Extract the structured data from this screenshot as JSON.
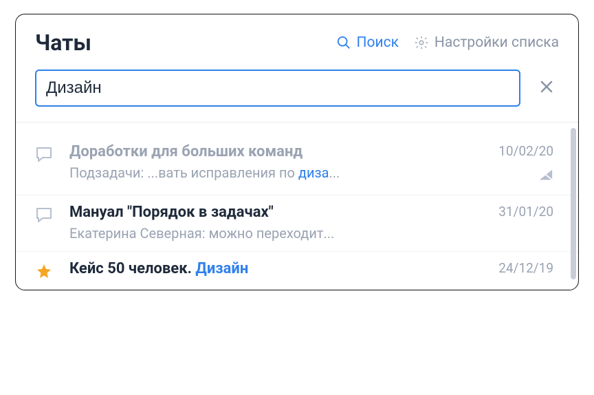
{
  "header": {
    "title": "Чаты",
    "search_link": "Поиск",
    "settings_link": "Настройки списка"
  },
  "search": {
    "value": "Дизайн"
  },
  "list": [
    {
      "icon": "bubble",
      "title_muted": true,
      "title_pre": "Доработки для больших команд",
      "title_hl": "",
      "title_post": "",
      "sub_pre": "Подзадачи: ...вать исправления по ",
      "sub_hl": "диза",
      "sub_post": "...",
      "date": "10/02/20",
      "muted": true
    },
    {
      "icon": "bubble",
      "title_muted": false,
      "title_pre": "Мануал \"Порядок в задачах\"",
      "title_hl": "",
      "title_post": "",
      "sub_pre": "Екатерина Северная: можно переходит...",
      "sub_hl": "",
      "sub_post": "",
      "date": "31/01/20",
      "muted": false
    },
    {
      "icon": "star",
      "title_muted": false,
      "title_pre": "Кейс 50 человек. ",
      "title_hl": "Дизайн",
      "title_post": "",
      "sub_pre": "",
      "sub_hl": "",
      "sub_post": "",
      "date": "24/12/19",
      "muted": false
    }
  ]
}
